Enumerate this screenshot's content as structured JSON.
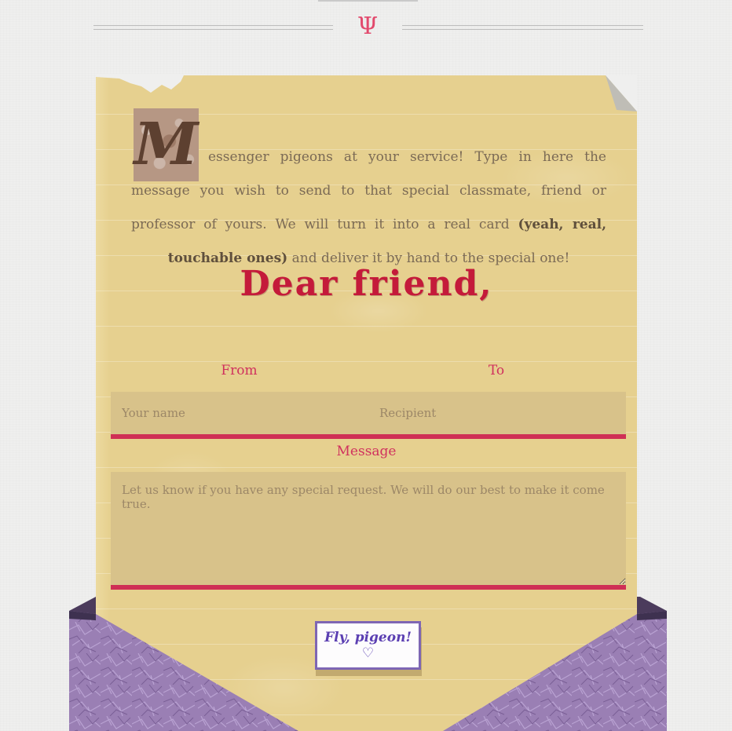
{
  "header": {
    "ornament_glyph": "Ψ"
  },
  "letter": {
    "dropcap": "M",
    "intro_start": "essenger pigeons at your service! Type in here the message you wish to send to that special classmate, friend or professor of yours. We will turn it into a real card ",
    "intro_bold": "(yeah, real, touchable ones)",
    "intro_end": " and deliver it by hand to the special one!",
    "greeting": "Dear friend,"
  },
  "form": {
    "from_label": "From",
    "to_label": "To",
    "from_placeholder": "Your name",
    "to_placeholder": "Recipient",
    "message_label": "Message",
    "message_placeholder": "Let us know if you have any special request. We will do our best to make it come true.",
    "submit_label": "Fly, pigeon! ♡"
  },
  "colors": {
    "paper": "#e6d08f",
    "accent": "#cf2f55",
    "greeting": "#c41a3a",
    "button": "#5b3fb2",
    "envelope": "#9a7fb4"
  }
}
